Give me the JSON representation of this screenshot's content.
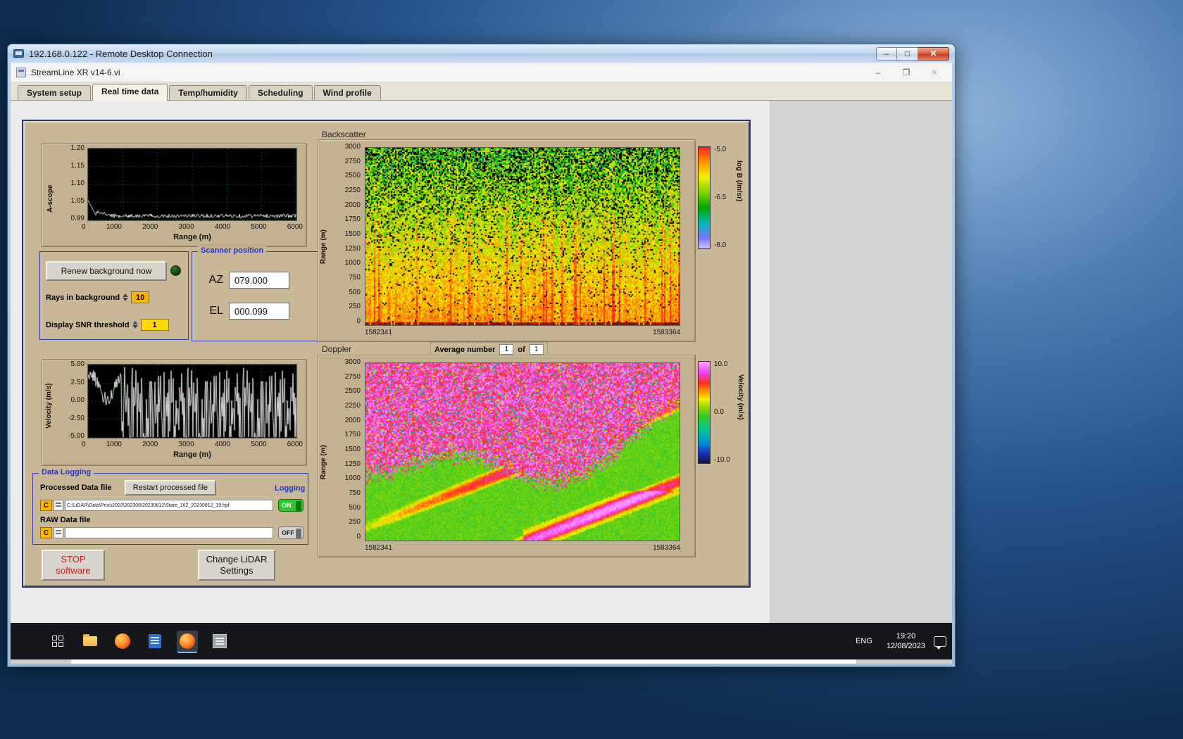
{
  "rdp": {
    "title": "192.168.0.122 - Remote Desktop Connection"
  },
  "app": {
    "title": "StreamLine XR v14-6.vi"
  },
  "tabs": [
    {
      "label": "System setup"
    },
    {
      "label": "Real time data"
    },
    {
      "label": "Temp/humidity"
    },
    {
      "label": "Scheduling"
    },
    {
      "label": "Wind profile"
    }
  ],
  "ascope": {
    "ylabel": "A-scope",
    "xlabel": "Range (m)",
    "yticks": [
      "1.20",
      "1.15",
      "1.10",
      "1.05",
      "0.99"
    ],
    "xticks": [
      "0",
      "1000",
      "2000",
      "3000",
      "4000",
      "5000",
      "6000"
    ],
    "ylim": [
      0.99,
      1.2
    ],
    "xlim": [
      0,
      6000
    ]
  },
  "background_controls": {
    "renew_button": "Renew background now",
    "rays_label": "Rays in background",
    "rays_value": "10",
    "snr_label": "Display SNR threshold",
    "snr_value": "1"
  },
  "scanner": {
    "title": "Scanner position",
    "az_label": "AZ",
    "az_value": "079.000",
    "el_label": "EL",
    "el_value": "000.099"
  },
  "backscatter": {
    "title": "Backscatter",
    "ylabel": "Range (m)",
    "yticks": [
      "3000",
      "2750",
      "2500",
      "2250",
      "2000",
      "1750",
      "1500",
      "1250",
      "1000",
      "750",
      "500",
      "250",
      "0"
    ],
    "x_start": "1582341",
    "x_end": "1583364",
    "colorbar_label": "log B (/m/sr)",
    "colorbar_ticks": [
      "-5.0",
      "-6.5",
      "-8.0"
    ]
  },
  "doppler": {
    "title": "Doppler",
    "avg_label": "Average number",
    "avg_value": "1",
    "of_label": "of",
    "of_total": "1",
    "ylabel": "Range (m)",
    "yticks": [
      "3000",
      "2750",
      "2500",
      "2250",
      "2000",
      "1750",
      "1500",
      "1250",
      "1000",
      "750",
      "500",
      "250",
      "0"
    ],
    "x_start": "1582341",
    "x_end": "1583364",
    "colorbar_label": "Velocity (m/s)",
    "colorbar_ticks": [
      "10.0",
      "0.0",
      "-10.0"
    ]
  },
  "velocity": {
    "ylabel": "Velocity (m/s)",
    "xlabel": "Range (m)",
    "yticks": [
      "5.00",
      "2.50",
      "0.00",
      "-2.50",
      "-5.00"
    ],
    "xticks": [
      "0",
      "1000",
      "2000",
      "3000",
      "4000",
      "5000",
      "6000"
    ],
    "ylim": [
      -5,
      5
    ],
    "xlim": [
      0,
      6000
    ]
  },
  "data_logging": {
    "title": "Data Logging",
    "processed_label": "Processed Data file",
    "restart_button": "Restart processed file",
    "logging_label": "Logging",
    "drive_letter": "C",
    "processed_path": "C:\\LiDAR\\Data\\Proc\\2023\\202308\\20230812\\Stare_162_20230812_19.hpl",
    "raw_label": "RAW Data file",
    "raw_path": "",
    "on_label": "ON",
    "off_label": "OFF"
  },
  "actions": {
    "stop_line1": "STOP",
    "stop_line2": "software",
    "change_line1": "Change LiDAR",
    "change_line2": "Settings"
  },
  "taskbar": {
    "language": "ENG",
    "time": "19:20",
    "date": "12/08/2023"
  },
  "chart_data": [
    {
      "type": "line",
      "title": "A-scope",
      "xlabel": "Range (m)",
      "ylabel": "A-scope",
      "xlim": [
        0,
        6000
      ],
      "ylim": [
        0.99,
        1.2
      ],
      "description": "White trace on black grid: starts near 1.04 at range 0, decays to ~1.00 within ~400 m, then stays flat with small noise out to 6000 m"
    },
    {
      "type": "heatmap",
      "title": "Backscatter",
      "ylabel": "Range (m)",
      "ylim": [
        0,
        3000
      ],
      "x_start": 1582341,
      "x_end": 1583364,
      "colorbar_label": "log B (/m/sr)",
      "colorbar_range": [
        -8.0,
        -5.0
      ],
      "description": "Solid yellow/orange high backscatter at low ranges grading into speckled yellow-green with black dropouts toward 3000 m; dark red/black strip at range 0"
    },
    {
      "type": "line",
      "title": "Velocity",
      "xlabel": "Range (m)",
      "ylabel": "Velocity (m/s)",
      "xlim": [
        0,
        6000
      ],
      "ylim": [
        -5,
        5
      ],
      "description": "Coherent ~+2.5 m/s signal below ~1000 m, then noise-dominated spikes spanning the full ±5 m/s scale to 6000 m"
    },
    {
      "type": "heatmap",
      "title": "Doppler",
      "ylabel": "Range (m)",
      "ylim": [
        0,
        3000
      ],
      "x_start": 1582341,
      "x_end": 1583364,
      "colorbar_label": "Velocity (m/s)",
      "colorbar_range": [
        -10,
        10
      ],
      "description": "Magenta/pink noise aloft above ~1300 m; coherent green near-zero velocities below with yellow-orange diagonal streak structures rising to the right"
    }
  ]
}
